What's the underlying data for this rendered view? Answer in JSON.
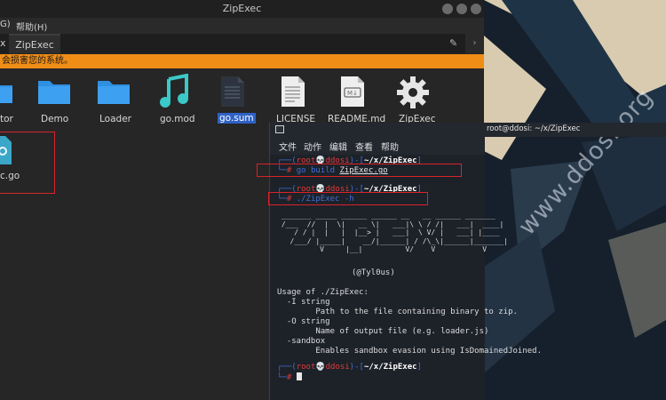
{
  "file_manager": {
    "title": "ZipExec",
    "menu": [
      "G)",
      "帮助(H)"
    ],
    "tabs": {
      "inactive_label": "x",
      "active_label": "ZipExec"
    },
    "warning_text": "会损害您的系统。",
    "items": [
      {
        "label": "tor",
        "icon": "folder-icon"
      },
      {
        "label": "Demo",
        "icon": "folder-icon"
      },
      {
        "label": "Loader",
        "icon": "folder-icon"
      },
      {
        "label": "go.mod",
        "icon": "music-file-icon"
      },
      {
        "label": "go.sum",
        "icon": "text-file-icon",
        "selected": true
      },
      {
        "label": "LICENSE",
        "icon": "document-icon"
      },
      {
        "label": "README.md",
        "icon": "markdown-icon"
      },
      {
        "label": "ZipExec",
        "icon": "gear-icon"
      },
      {
        "label": "c.go",
        "icon": "go-file-icon"
      }
    ]
  },
  "terminal": {
    "title": "root@ddosi: ~/x/ZipExec",
    "menu": [
      "文件",
      "动作",
      "编辑",
      "查看",
      "帮助"
    ],
    "prompt": {
      "user": "root💀ddosi",
      "path": "~/x/ZipExec"
    },
    "commands": [
      {
        "cmd": "go build",
        "arg": "ZipExec.go"
      },
      {
        "cmd": "./ZipExec -h"
      }
    ],
    "ascii_banner": " _______ _____ ______ ______ __   __ ______ _______\n /___  //  |  \\|   __ \\|   ___|\\ \\ / /|   ___|  ____|\n    / / |  |   |  |__> |   ___|  \\ V/ |   ___| |____\n   /___/ |_____|    __/|______| / /\\_\\|______|_______|\n          V     |__|          V/    V           V",
    "author": "(@Tyl0us)",
    "usage": [
      "Usage of ./ZipExec:",
      "  -I string",
      "        Path to the file containing binary to zip.",
      "  -O string",
      "        Name of output file (e.g. loader.js)",
      "  -sandbox",
      "        Enables sandbox evasion using IsDomainedJoined."
    ],
    "prompt_symbol": "#"
  },
  "watermark": "www.ddosi.org",
  "colors": {
    "warning_bar": "#f08d16",
    "highlight_box": "#d9232a",
    "folder": "#2f8fe0",
    "prompt_blue": "#3f6fd8",
    "prompt_red": "#e23b3b"
  }
}
